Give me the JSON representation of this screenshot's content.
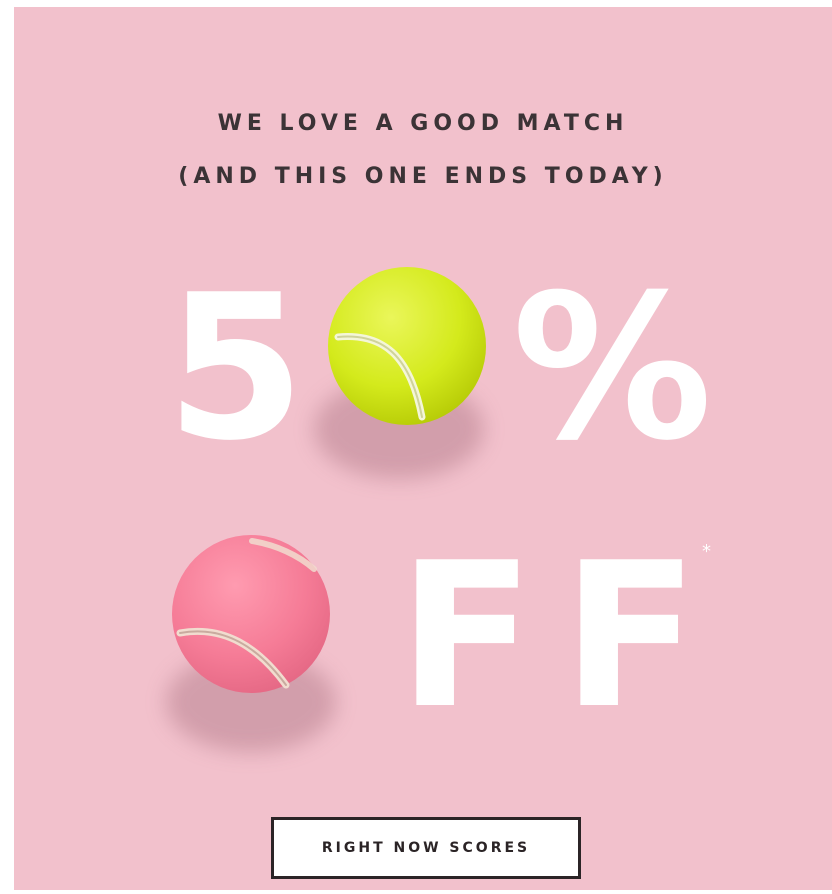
{
  "headline": {
    "line1": "WE LOVE A GOOD MATCH",
    "line2": "(AND THIS ONE ENDS TODAY)"
  },
  "offer": {
    "digit_five": "5",
    "percent": "%",
    "letter_f1": "F",
    "letter_f2": "F",
    "asterisk": "*"
  },
  "cta": {
    "label": "RIGHT NOW SCORES"
  },
  "colors": {
    "background": "#f2c1cc",
    "headline_text": "#3b3336",
    "offer_text": "#ffffff",
    "ball_green": "#d4ea1c",
    "ball_pink": "#f57b96",
    "button_border": "#2b2426"
  },
  "icons": {
    "green_ball": "tennis-ball-icon",
    "pink_ball": "tennis-ball-icon"
  }
}
